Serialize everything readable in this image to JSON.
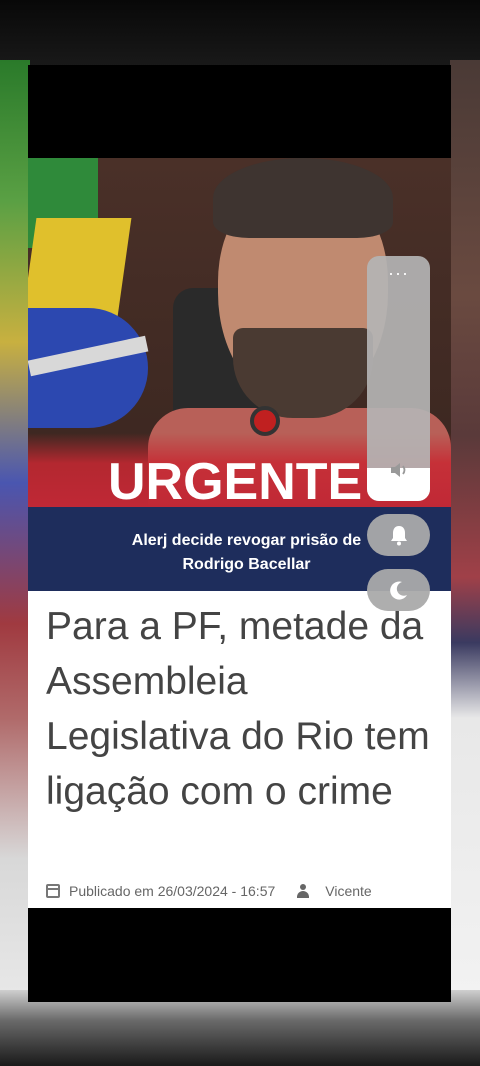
{
  "image": {
    "banner_text": "URGENTE",
    "caption": [
      "Alerj decide revogar prisão de",
      "Rodrigo Bacellar"
    ]
  },
  "article": {
    "headline": "Para a PF, metade da Assembleia Legislativa do Rio tem ligação com o crime",
    "published": "Publicado em 26/03/2024 - 16:57",
    "author": "Vicente"
  },
  "controls": {
    "menu_dots": "···",
    "volume_icon": "volume-icon",
    "bell_icon": "bell-icon",
    "moon_icon": "moon-icon"
  },
  "colors": {
    "caption_bg": "#1e2d5c",
    "urgent_red": "#c02836"
  }
}
